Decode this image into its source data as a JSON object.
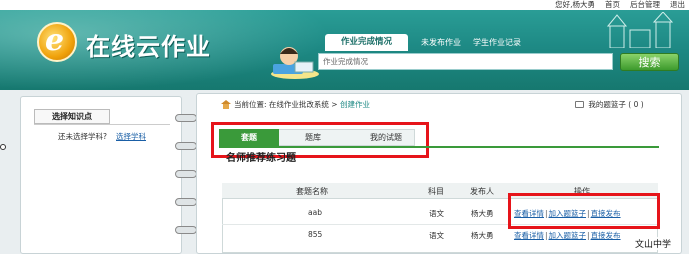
{
  "topbar": {
    "greeting": "您好,杨大勇",
    "home": "首页",
    "admin": "后台管理",
    "logout": "退出"
  },
  "header": {
    "logo_letter": "e",
    "app_name": "在线云作业",
    "nav": {
      "active": "作业完成情况",
      "unpublished": "未发布作业",
      "records": "学生作业记录"
    },
    "search": {
      "placeholder": "作业完成情况",
      "button": "搜索"
    }
  },
  "sidebar": {
    "title": "选择知识点",
    "prompt": "还未选择学科?",
    "link": "选择学科"
  },
  "breadcrumb": {
    "prefix": "当前位置:",
    "path": "在线作业批改系统 > ",
    "current": "创建作业"
  },
  "basket": {
    "label": "我的题篮子",
    "count": "( 0 )"
  },
  "subtabs": [
    "套题",
    "题库",
    "我的试题"
  ],
  "section_title": "名师推荐练习题",
  "table": {
    "headers": [
      "套题名称",
      "科目",
      "发布人",
      "操作"
    ],
    "rows": [
      {
        "name": "aab",
        "subject": "语文",
        "publisher": "杨大勇",
        "ops": [
          "查看详情",
          "加入题篮子",
          "直接发布"
        ]
      },
      {
        "name": "855",
        "subject": "语文",
        "publisher": "杨大勇",
        "ops": [
          "查看详情",
          "加入题篮子",
          "直接发布"
        ]
      }
    ]
  },
  "watermark": "文山中学",
  "colors": {
    "header": "#1e8a85",
    "accent_green": "#3a9a3a",
    "highlight_red": "#e6141a",
    "link_blue": "#1a5fa6"
  },
  "icons": [
    "e-logo-icon",
    "home-icon",
    "basket-icon",
    "castle-icon",
    "boy-illustration-icon"
  ]
}
